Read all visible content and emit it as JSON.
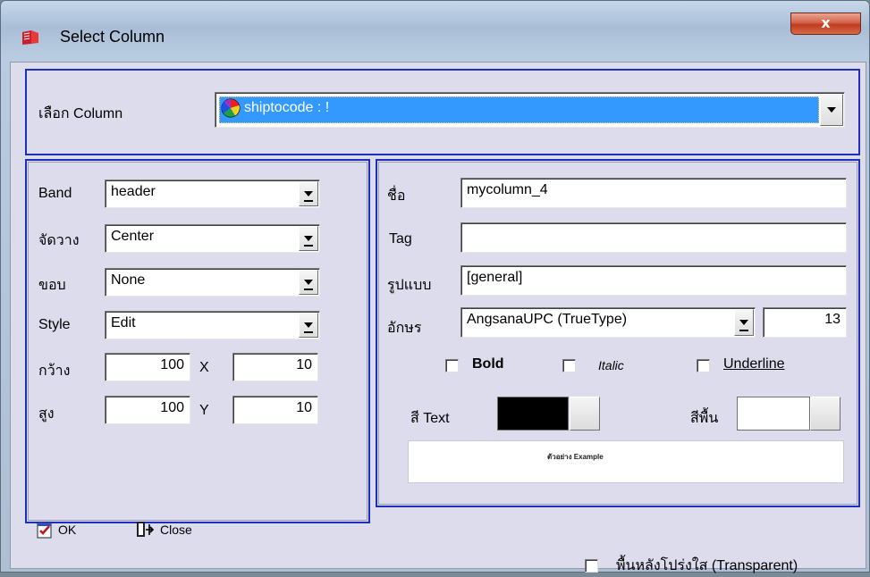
{
  "window": {
    "title": "Select Column",
    "close_label": "x"
  },
  "column_select": {
    "label": "เลือก Column",
    "value": "shiptocode : !"
  },
  "left": {
    "band": {
      "label": "Band",
      "value": "header"
    },
    "align": {
      "label": "จัดวาง",
      "value": "Center"
    },
    "border": {
      "label": "ขอบ",
      "value": "None"
    },
    "style": {
      "label": "Style",
      "value": "Edit"
    },
    "width": {
      "label": "กว้าง",
      "value": "100",
      "x_label": "X",
      "x_value": "10"
    },
    "height": {
      "label": "สูง",
      "value": "100",
      "y_label": "Y",
      "y_value": "10"
    }
  },
  "right": {
    "name": {
      "label": "ชื่อ",
      "value": "mycolumn_4"
    },
    "tag": {
      "label": "Tag",
      "value": ""
    },
    "format": {
      "label": "รูปแบบ",
      "value": "[general]"
    },
    "font": {
      "label": "อักษร",
      "value": "AngsanaUPC (TrueType)",
      "size": "13"
    },
    "bold": {
      "label": "Bold",
      "checked": false
    },
    "italic": {
      "label": "Italic",
      "checked": false
    },
    "underline": {
      "label": "Underline",
      "checked": false
    },
    "text_color": {
      "label": "สี Text",
      "color": "#000000"
    },
    "bg_color": {
      "label": "สีพื้น",
      "color": "#ffffff"
    },
    "preview_text": "ตัวอย่าง Example"
  },
  "footer": {
    "ok_label": "OK",
    "close_label": "Close",
    "transparent_label": "พื้นหลังโปร่งใส (Transparent)",
    "transparent_checked": false
  },
  "colors": {
    "selection": "#3399ff",
    "group_border": "#1d2fbf",
    "dialog_bg": "#dcdcec"
  },
  "icons": {
    "title": "report-icon",
    "column": "color-wheel-icon",
    "ok": "checked-doc-icon",
    "close": "exit-door-icon"
  }
}
